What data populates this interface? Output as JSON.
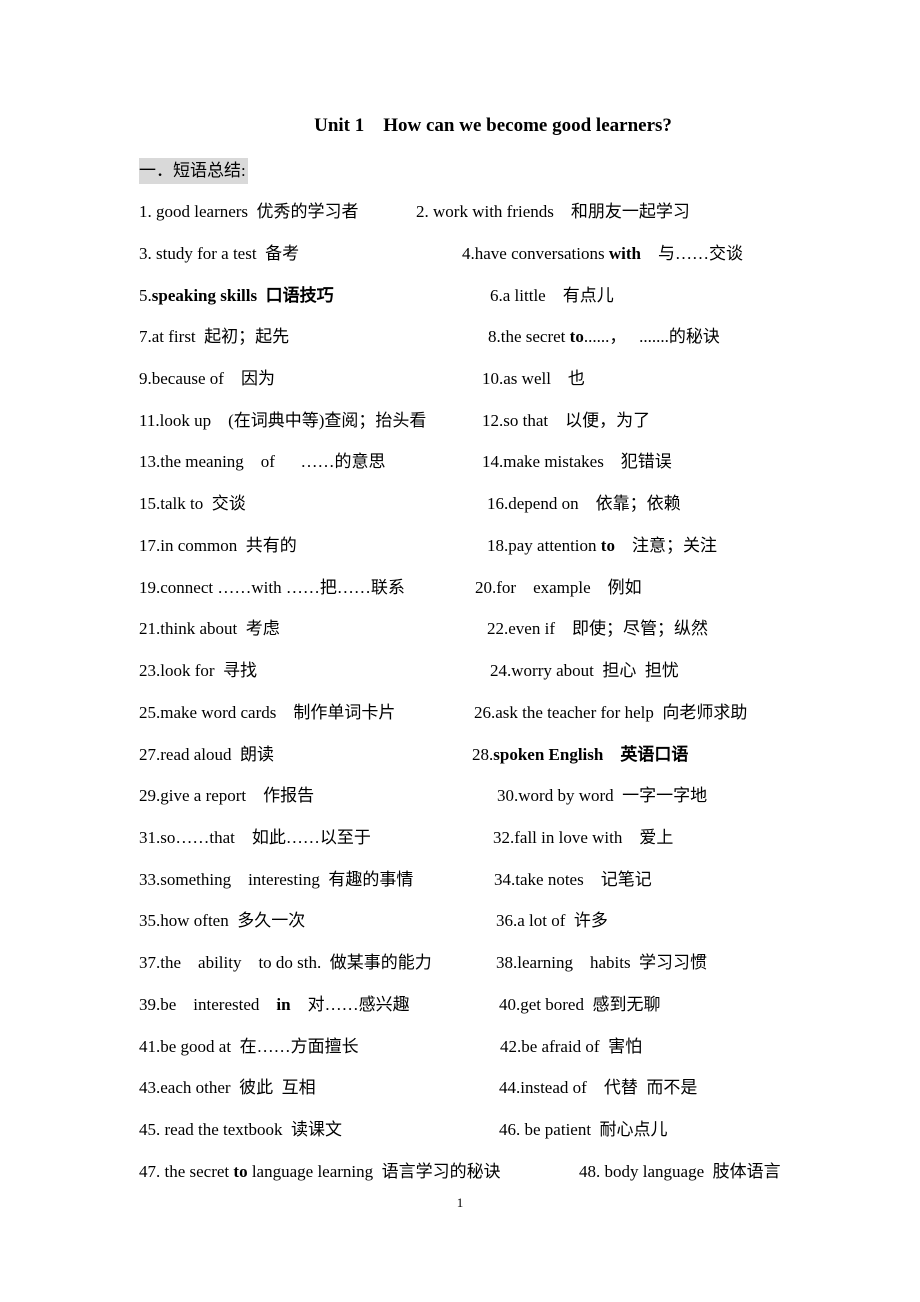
{
  "title": "Unit 1    How can we become good learners?",
  "section_heading": "一．短语总结:",
  "page_number": "1",
  "rows": [
    {
      "left": [
        {
          "t": "1. good learners  优秀的学习者"
        }
      ],
      "right": [
        {
          "t": "2. work with friends    和朋友一起学习"
        }
      ]
    },
    {
      "left": [
        {
          "t": "3. study for a test  备考"
        }
      ],
      "right": [
        {
          "t": "4.have conversations "
        },
        {
          "t": "with",
          "b": true
        },
        {
          "t": "    与……交谈"
        }
      ]
    },
    {
      "left": [
        {
          "t": "5."
        },
        {
          "t": "speaking skills  口语技巧",
          "b": true
        }
      ],
      "right": [
        {
          "t": "6.a little    有点儿"
        }
      ]
    },
    {
      "left": [
        {
          "t": "7.at first  起初；起先"
        }
      ],
      "right": [
        {
          "t": "8.the secret "
        },
        {
          "t": "to",
          "b": true
        },
        {
          "t": "......，   .......的秘诀"
        }
      ]
    },
    {
      "left": [
        {
          "t": "9.because of    因为"
        }
      ],
      "right": [
        {
          "t": "10.as well    也"
        }
      ]
    },
    {
      "left": [
        {
          "t": "11.look up    (在词典中等)查阅；抬头看"
        }
      ],
      "right": [
        {
          "t": "12.so that    以便，为了"
        }
      ]
    },
    {
      "left": [
        {
          "t": "13.the meaning    of      ……的意思"
        }
      ],
      "right": [
        {
          "t": "14.make mistakes    犯错误"
        }
      ]
    },
    {
      "left": [
        {
          "t": "15.talk to  交谈"
        }
      ],
      "right": [
        {
          "t": "16.depend on    依靠；依赖"
        }
      ]
    },
    {
      "left": [
        {
          "t": "17.in common  共有的"
        }
      ],
      "right": [
        {
          "t": "18.pay attention "
        },
        {
          "t": "to",
          "b": true
        },
        {
          "t": "    注意；关注"
        }
      ]
    },
    {
      "left": [
        {
          "t": "19.connect ……with ……把……联系"
        }
      ],
      "right": [
        {
          "t": "20.for    example    例如"
        }
      ]
    },
    {
      "left": [
        {
          "t": "21.think about  考虑"
        }
      ],
      "right": [
        {
          "t": "22.even if    即使；尽管；纵然"
        }
      ]
    },
    {
      "left": [
        {
          "t": "23.look for  寻找"
        }
      ],
      "right": [
        {
          "t": "24.worry about  担心  担忧"
        }
      ]
    },
    {
      "left": [
        {
          "t": "25.make word cards    制作单词卡片"
        }
      ],
      "right": [
        {
          "t": "26.ask the teacher for help  向老师求助"
        }
      ]
    },
    {
      "left": [
        {
          "t": "27.read aloud  朗读"
        }
      ],
      "right": [
        {
          "t": "28."
        },
        {
          "t": "spoken English    英语口语",
          "b": true
        }
      ]
    },
    {
      "left": [
        {
          "t": "29.give a report    作报告"
        }
      ],
      "right": [
        {
          "t": "30.word by word  一字一字地"
        }
      ]
    },
    {
      "left": [
        {
          "t": "31.so……that    如此……以至于"
        }
      ],
      "right": [
        {
          "t": "32.fall in love with    爱上"
        }
      ]
    },
    {
      "left": [
        {
          "t": "33.something    interesting  有趣的事情"
        }
      ],
      "right": [
        {
          "t": "34.take notes    记笔记"
        }
      ]
    },
    {
      "left": [
        {
          "t": "35.how often  多久一次"
        }
      ],
      "right": [
        {
          "t": "36.a lot of  许多"
        }
      ]
    },
    {
      "left": [
        {
          "t": "37.the    ability    to do sth.  做某事的能力"
        }
      ],
      "right": [
        {
          "t": "38.learning    habits  学习习惯"
        }
      ]
    },
    {
      "left": [
        {
          "t": "39.be    interested    "
        },
        {
          "t": "in",
          "b": true
        },
        {
          "t": "    对……感兴趣"
        }
      ],
      "right": [
        {
          "t": "40.get bored  感到无聊"
        }
      ]
    },
    {
      "left": [
        {
          "t": "41.be good at  在……方面擅长"
        }
      ],
      "right": [
        {
          "t": "42.be afraid of  害怕"
        }
      ]
    },
    {
      "left": [
        {
          "t": "43.each other  彼此  互相"
        }
      ],
      "right": [
        {
          "t": "44.instead of    代替  而不是"
        }
      ]
    },
    {
      "left": [
        {
          "t": "45. read the textbook  读课文"
        }
      ],
      "right": [
        {
          "t": "46. be patient  耐心点儿"
        }
      ]
    },
    {
      "left": [
        {
          "t": "47. the secret "
        },
        {
          "t": "to",
          "b": true
        },
        {
          "t": " language learning  语言学习的秘诀"
        }
      ],
      "right": [
        {
          "t": "48. body language  肢体语言"
        }
      ]
    }
  ]
}
